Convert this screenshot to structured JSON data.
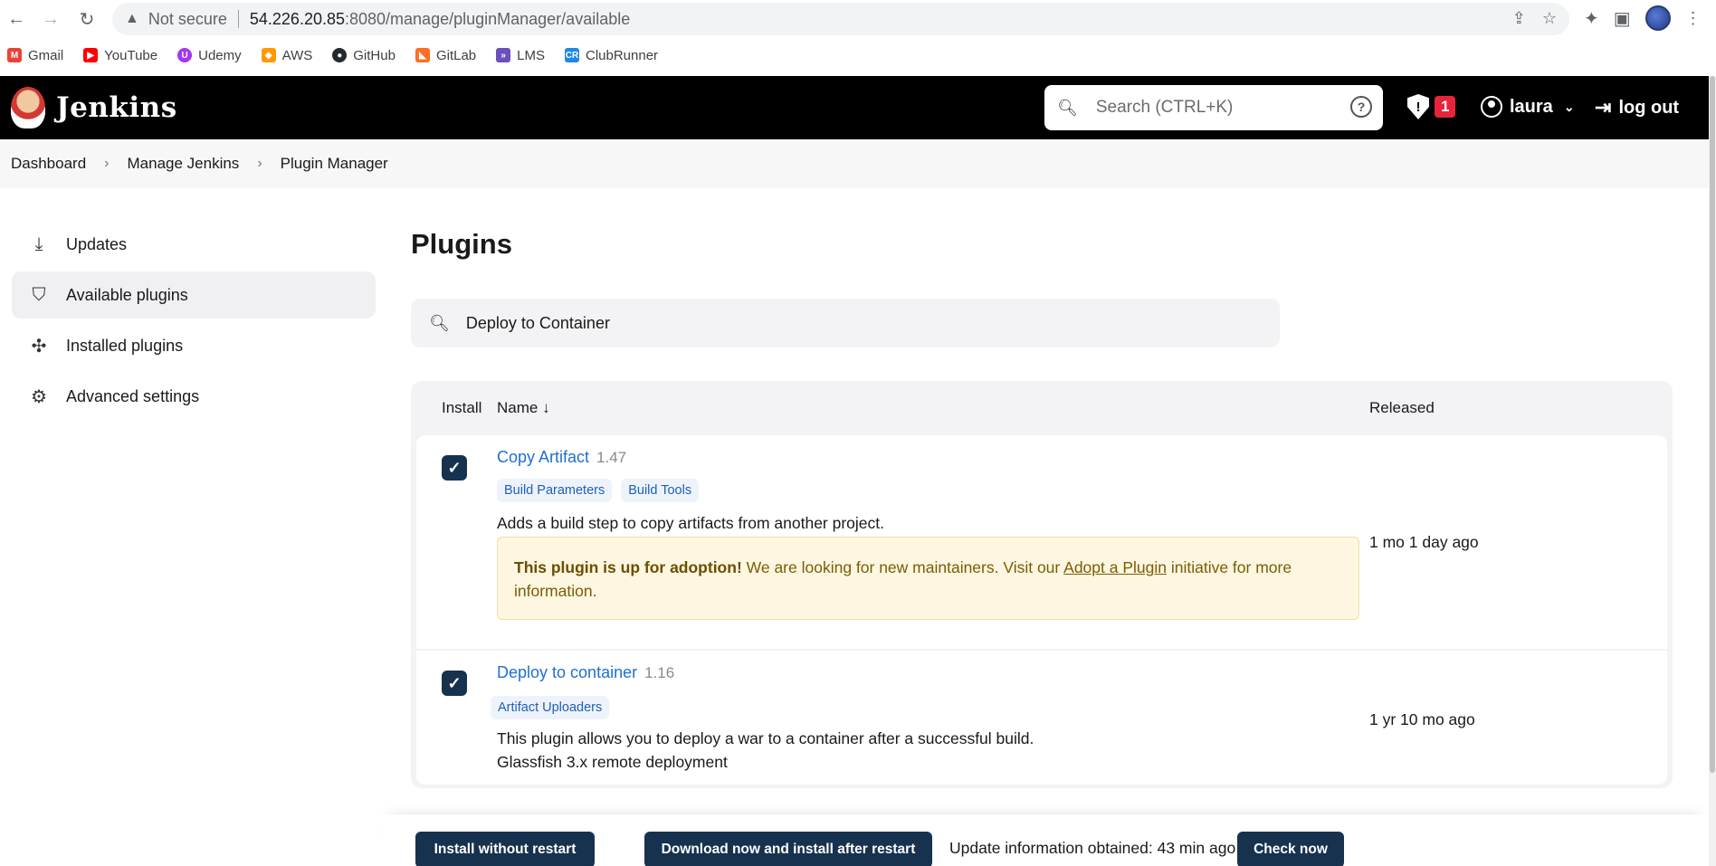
{
  "browser": {
    "security_label": "Not secure",
    "url_host": "54.226.20.85",
    "url_rest": ":8080/manage/pluginManager/available"
  },
  "bookmarks": [
    {
      "label": "Gmail",
      "color": "#ea4335",
      "icon": "gmail-icon"
    },
    {
      "label": "YouTube",
      "color": "#ff0000",
      "icon": "youtube-icon"
    },
    {
      "label": "Udemy",
      "color": "#a435f0",
      "icon": "udemy-icon"
    },
    {
      "label": "AWS",
      "color": "#ff9900",
      "icon": "aws-icon"
    },
    {
      "label": "GitHub",
      "color": "#24292e",
      "icon": "github-icon"
    },
    {
      "label": "GitLab",
      "color": "#fc6d26",
      "icon": "gitlab-icon"
    },
    {
      "label": "LMS",
      "color": "#6b4fbb",
      "icon": "lms-icon"
    },
    {
      "label": "ClubRunner",
      "color": "#1e88e5",
      "icon": "clubrunner-icon"
    }
  ],
  "header": {
    "logo_text": "Jenkins",
    "search_placeholder": "Search (CTRL+K)",
    "alert_count": "1",
    "username": "laura",
    "logout_label": "log out"
  },
  "breadcrumb": [
    "Dashboard",
    "Manage Jenkins",
    "Plugin Manager"
  ],
  "sidebar": {
    "items": [
      {
        "label": "Updates",
        "icon": "download-icon"
      },
      {
        "label": "Available plugins",
        "icon": "shopping-bag-icon"
      },
      {
        "label": "Installed plugins",
        "icon": "puzzle-icon"
      },
      {
        "label": "Advanced settings",
        "icon": "gear-icon"
      }
    ]
  },
  "main": {
    "title": "Plugins",
    "filter_value": "Deploy to Container",
    "columns": {
      "install": "Install",
      "name": "Name ↓",
      "released": "Released"
    },
    "plugins": [
      {
        "name": "Copy Artifact",
        "version": "1.47",
        "checked": true,
        "tags": [
          "Build Parameters",
          "Build Tools"
        ],
        "description": "Adds a build step to copy artifacts from another project.",
        "adoption_bold": "This plugin is up for adoption!",
        "adoption_text": " We are looking for new maintainers. Visit our ",
        "adoption_link": "Adopt a Plugin",
        "adoption_tail": " initiative for more information.",
        "released": "1 mo 1 day ago"
      },
      {
        "name": "Deploy to container",
        "version": "1.16",
        "checked": true,
        "tags": [
          "Artifact Uploaders"
        ],
        "description": "This plugin allows you to deploy a war to a container after a successful build.",
        "description2": "Glassfish 3.x remote deployment",
        "released": "1 yr 10 mo ago"
      }
    ]
  },
  "footer": {
    "install_without_restart": "Install without restart",
    "download_and_install": "Download now and install after restart",
    "update_info": "Update information obtained: 43 min ago",
    "check_now": "Check now"
  },
  "colors": {
    "header_bg": "#000000",
    "primary_button": "#17324f",
    "link": "#1f6fd1",
    "alert": "#e6243a",
    "adoption_bg": "#fdf6e0"
  }
}
